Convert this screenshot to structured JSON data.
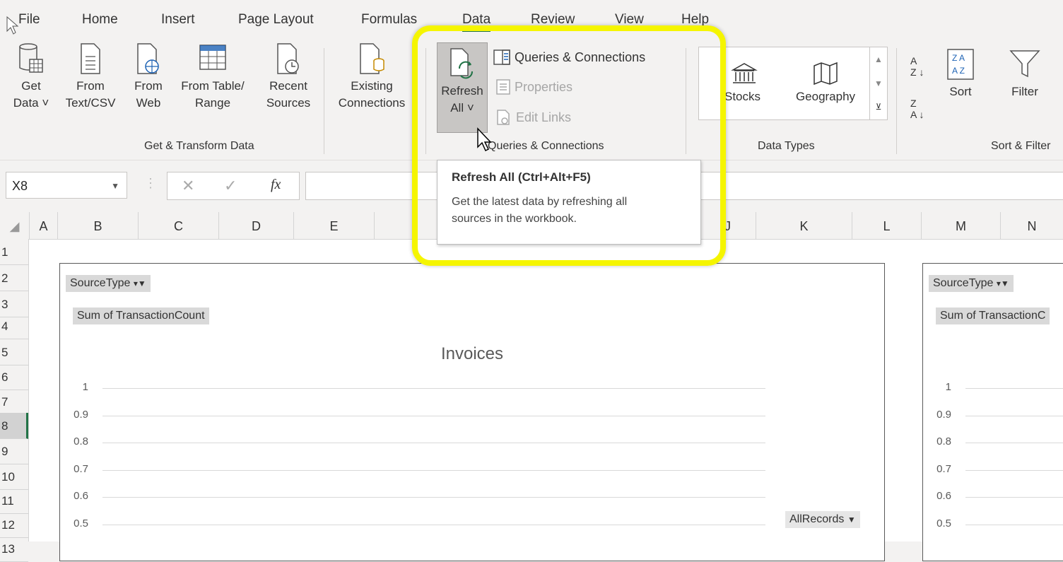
{
  "tabs": [
    "File",
    "Home",
    "Insert",
    "Page Layout",
    "Formulas",
    "Data",
    "Review",
    "View",
    "Help"
  ],
  "active_tab": "Data",
  "ribbon": {
    "get_transform": {
      "get_data": {
        "line1": "Get",
        "line2": "Data ˅"
      },
      "from_text": {
        "line1": "From",
        "line2": "Text/CSV"
      },
      "from_web": {
        "line1": "From",
        "line2": "Web"
      },
      "from_table": {
        "line1": "From Table/",
        "line2": "Range"
      },
      "recent_sources": {
        "line1": "Recent",
        "line2": "Sources"
      },
      "existing_conn": {
        "line1": "Existing",
        "line2": "Connections"
      },
      "group_label": "Get & Transform Data"
    },
    "queries": {
      "refresh_all": {
        "line1": "Refresh",
        "line2": "All ˅"
      },
      "queries_connections": "Queries & Connections",
      "properties": "Properties",
      "edit_links": "Edit Links",
      "group_label": "Queries & Connections"
    },
    "data_types": {
      "stocks": "Stocks",
      "geography": "Geography",
      "group_label": "Data Types"
    },
    "sort_filter": {
      "sort": "Sort",
      "filter": "Filter",
      "group_label": "Sort & Filter"
    }
  },
  "formula_bar": {
    "name_box": "X8",
    "fx": "fx",
    "value": ""
  },
  "columns": [
    "A",
    "B",
    "C",
    "D",
    "E",
    "",
    "J",
    "K",
    "L",
    "M",
    "N"
  ],
  "rows": [
    "1",
    "2",
    "3",
    "4",
    "5",
    "6",
    "7",
    "8",
    "9",
    "10",
    "11",
    "12",
    "13"
  ],
  "selected_row": "8",
  "tooltip": {
    "title": "Refresh All (Ctrl+Alt+F5)",
    "body_line1": "Get the latest data by refreshing all",
    "body_line2": "sources in the workbook."
  },
  "chart_data": [
    {
      "type": "bar",
      "title": "Invoices",
      "filter_button": "SourceType",
      "value_button": "Sum of TransactionCount",
      "axis_button": "AllRecords",
      "ytick_labels": [
        "1",
        "0.9",
        "0.8",
        "0.7",
        "0.6",
        "0.5"
      ],
      "ylim": [
        0.5,
        1
      ],
      "grid": true
    },
    {
      "type": "bar",
      "title": "",
      "filter_button": "SourceType",
      "value_button": "Sum of TransactionC",
      "ytick_labels": [
        "1",
        "0.9",
        "0.8",
        "0.7",
        "0.6",
        "0.5"
      ],
      "ylim": [
        0.5,
        1
      ],
      "grid": true
    }
  ]
}
